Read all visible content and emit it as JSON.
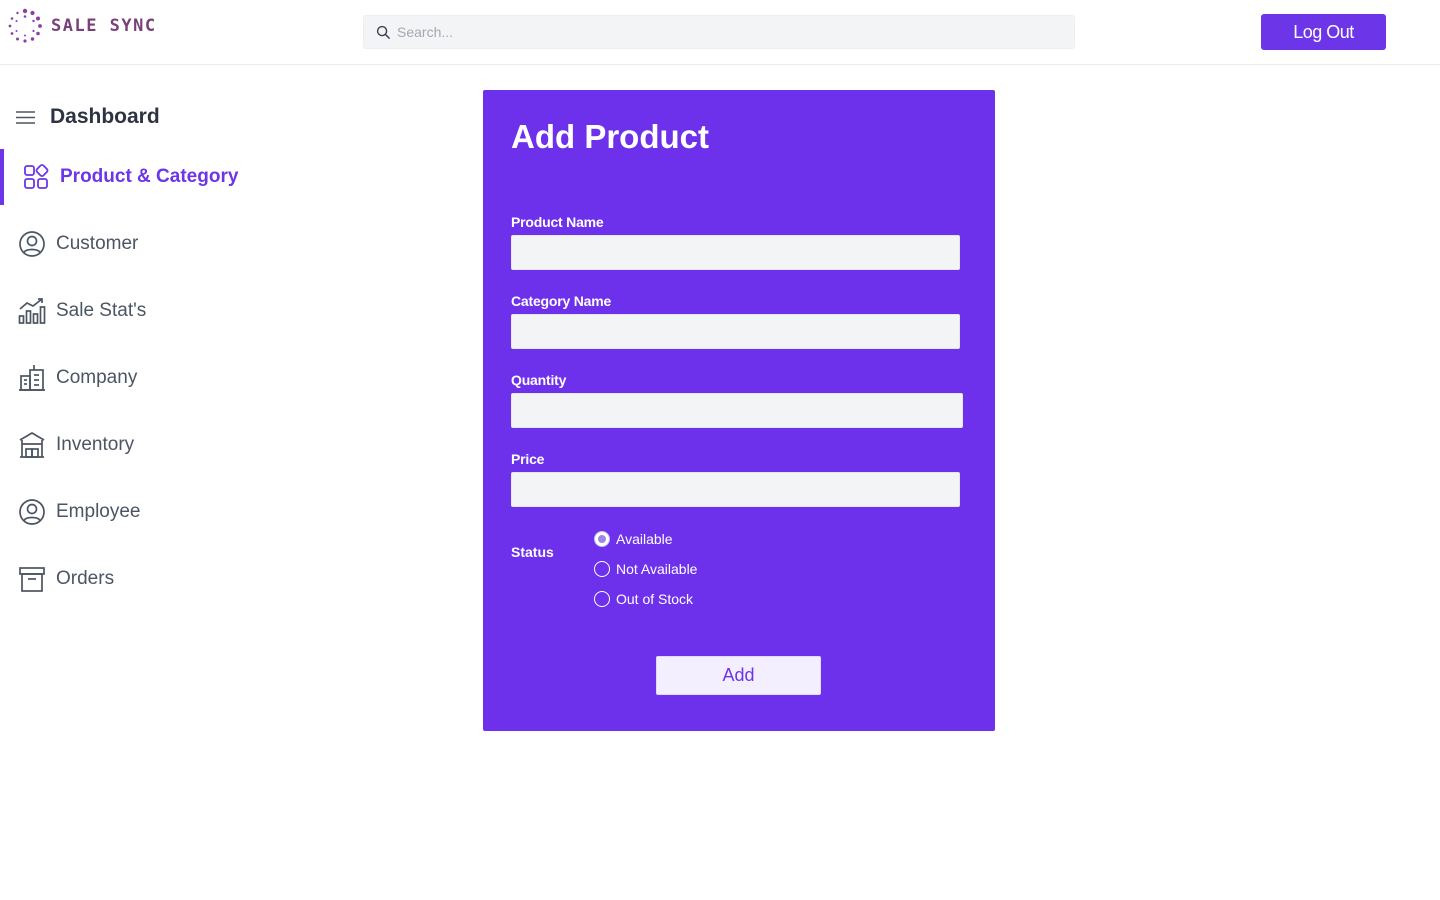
{
  "header": {
    "logo_text": "SALE SYNC",
    "search_placeholder": "Search...",
    "logout_label": "Log Out"
  },
  "sidebar": {
    "title": "Dashboard",
    "items": [
      {
        "label": "Product & Category",
        "icon": "grid-shapes-icon",
        "active": true
      },
      {
        "label": "Customer",
        "icon": "user-circle-icon"
      },
      {
        "label": "Sale Stat's",
        "icon": "bar-chart-icon"
      },
      {
        "label": "Company",
        "icon": "buildings-icon"
      },
      {
        "label": "Inventory",
        "icon": "warehouse-icon"
      },
      {
        "label": "Employee",
        "icon": "user-circle-icon"
      },
      {
        "label": "Orders",
        "icon": "archive-box-icon"
      }
    ]
  },
  "form": {
    "title": "Add Product",
    "fields": [
      {
        "label": "Product Name",
        "value": ""
      },
      {
        "label": "Category Name",
        "value": ""
      },
      {
        "label": "Quantity",
        "value": ""
      },
      {
        "label": "Price",
        "value": ""
      }
    ],
    "status_label": "Status",
    "status_options": [
      "Available",
      "Not Available",
      "Out of Stock"
    ],
    "status_selected": "Available",
    "submit_label": "Add"
  },
  "colors": {
    "accent": "#6d35e8",
    "card_bg": "#6d31ec",
    "input_bg": "#f3f4f6",
    "add_button_bg": "#f4efff"
  }
}
